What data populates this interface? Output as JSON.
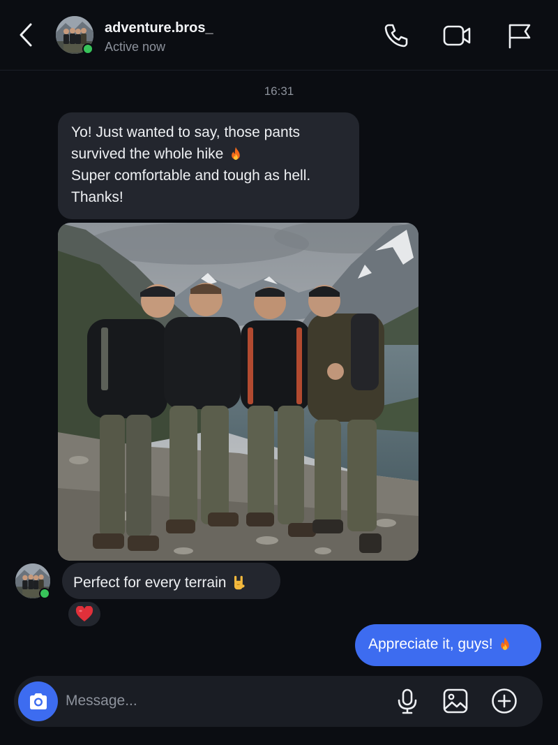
{
  "header": {
    "username": "adventure.bros_",
    "status": "Active now",
    "icons": [
      "back-icon",
      "phone-icon",
      "video-icon",
      "flag-icon"
    ]
  },
  "conversation": {
    "timestamp": "16:31",
    "messages": [
      {
        "sender": "adventure.bros_",
        "lines": [
          "Yo! Just wanted to say, those pants",
          "survived the whole hike",
          "Super comfortable and tough as hell.",
          "Thanks!"
        ],
        "emoji": "fire"
      },
      {
        "sender": "adventure.bros_",
        "type": "photo"
      },
      {
        "sender": "adventure.bros_",
        "text": "Perfect for every terrain",
        "emoji": "sign-of-horns",
        "reaction": "heart"
      },
      {
        "sender": "me",
        "text": "Appreciate it, guys!",
        "emoji": "fire"
      }
    ]
  },
  "composer": {
    "placeholder": "Message...",
    "icons": [
      "camera-icon",
      "microphone-icon",
      "gallery-icon",
      "add-icon"
    ]
  },
  "colors": {
    "background": "#0b0d12",
    "incoming_bubble": "#23262e",
    "outgoing_bubble": "#3d6cf0",
    "online": "#38c45a",
    "muted_text": "#8d929c"
  }
}
